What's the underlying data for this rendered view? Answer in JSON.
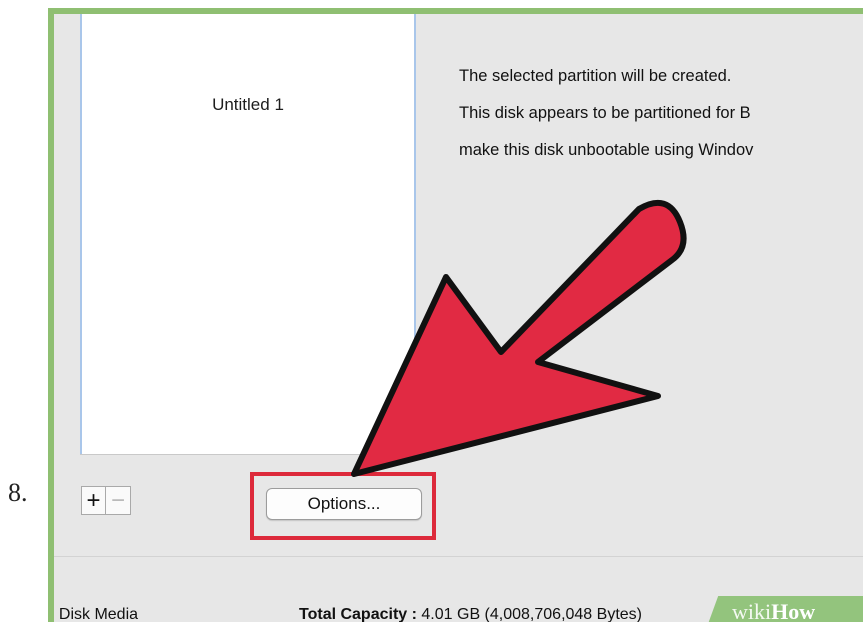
{
  "step": {
    "number": "8."
  },
  "partition_map": {
    "label": "Untitled 1"
  },
  "info": {
    "line1": "The selected partition will be created.",
    "line2": "This disk appears to be partitioned for B",
    "line3": "make this disk unbootable using Windov"
  },
  "buttons": {
    "add": "+",
    "remove": "−",
    "options": "Options..."
  },
  "footer": {
    "media": "‘h Disk Media",
    "capacity_label": "Total Capacity :",
    "capacity_value": "4.01 GB (4,008,706,048 Bytes)"
  },
  "watermark": {
    "part1": "wiki",
    "part2": "How"
  },
  "colors": {
    "arrow": "#e12a43",
    "highlight": "#dd2a3b",
    "frame": "#8fbf72"
  },
  "icons": {
    "pointer": "red-arrow-icon"
  }
}
